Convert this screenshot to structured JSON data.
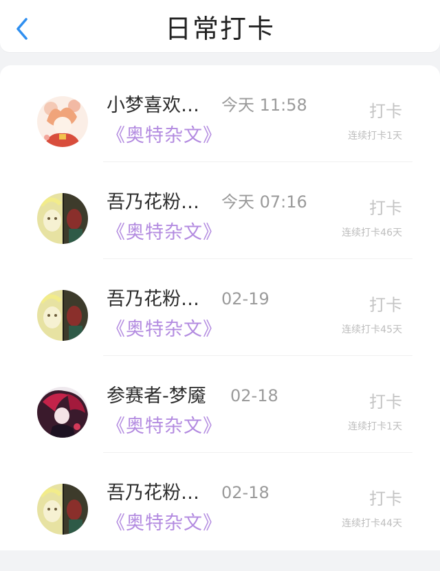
{
  "header": {
    "title": "日常打卡",
    "back_icon": "chevron-left-icon",
    "accent": "#2f8ff0"
  },
  "checkins": [
    {
      "name": "小梦喜欢…",
      "time": "今天 11:58",
      "topic": "《奥特杂文》",
      "button": "打卡",
      "streak": "连续打卡1天",
      "avatar": "anime-girl-avatar"
    },
    {
      "name": "吾乃花粉…",
      "time": "今天 07:16",
      "topic": "《奥特杂文》",
      "button": "打卡",
      "streak": "连续打卡46天",
      "avatar": "split-anime-avatar"
    },
    {
      "name": "吾乃花粉…",
      "time": "02-19",
      "topic": "《奥特杂文》",
      "button": "打卡",
      "streak": "连续打卡45天",
      "avatar": "split-anime-avatar"
    },
    {
      "name": "参赛者-梦魇",
      "time": "02-18",
      "topic": "《奥特杂文》",
      "button": "打卡",
      "streak": "连续打卡1天",
      "avatar": "dark-red-anime-avatar"
    },
    {
      "name": "吾乃花粉…",
      "time": "02-18",
      "topic": "《奥特杂文》",
      "button": "打卡",
      "streak": "连续打卡44天",
      "avatar": "split-anime-avatar"
    }
  ]
}
